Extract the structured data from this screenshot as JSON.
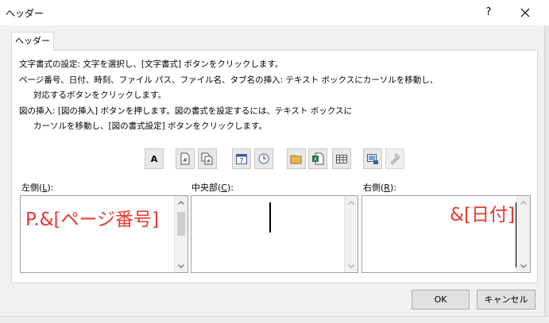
{
  "window": {
    "title": "ヘッダー",
    "help": "?"
  },
  "tab": {
    "label": "ヘッダー"
  },
  "instructions": [
    "文字書式の設定: 文字を選択し、[文字書式] ボタンをクリックします。",
    "ページ番号、日付、時刻、ファイル パス、ファイル名、タブ名の挿入: テキスト ボックスにカーソルを移動し、",
    "対応するボタンをクリックします。",
    "図の挿入: [図の挿入] ボタンを押します。図の書式を設定するには、テキスト ボックスに",
    "カーソルを移動し、[図の書式設定] ボタンをクリックします。"
  ],
  "toolbar": {
    "format_text_label": "A",
    "icons": [
      "format-text-icon",
      "insert-page-number-icon",
      "insert-number-of-pages-icon",
      "insert-date-icon",
      "insert-time-icon",
      "insert-file-path-icon",
      "insert-file-name-icon",
      "insert-sheet-name-icon",
      "insert-picture-icon",
      "format-picture-icon"
    ]
  },
  "sections": {
    "left": {
      "label_prefix": "左側(",
      "accel": "L",
      "label_suffix": "):",
      "text": "P.&[ページ番号]"
    },
    "center": {
      "label_prefix": "中央部(",
      "accel": "C",
      "label_suffix": "):",
      "text": ""
    },
    "right": {
      "label_prefix": "右側(",
      "accel": "R",
      "label_suffix": "):",
      "text": "&[日付]"
    }
  },
  "buttons": {
    "ok": "OK",
    "cancel": "キャンセル"
  },
  "colors": {
    "field_text": "#e8382f",
    "dialog_bg": "#f0f0f0",
    "button_bg": "#e1e1e1"
  }
}
